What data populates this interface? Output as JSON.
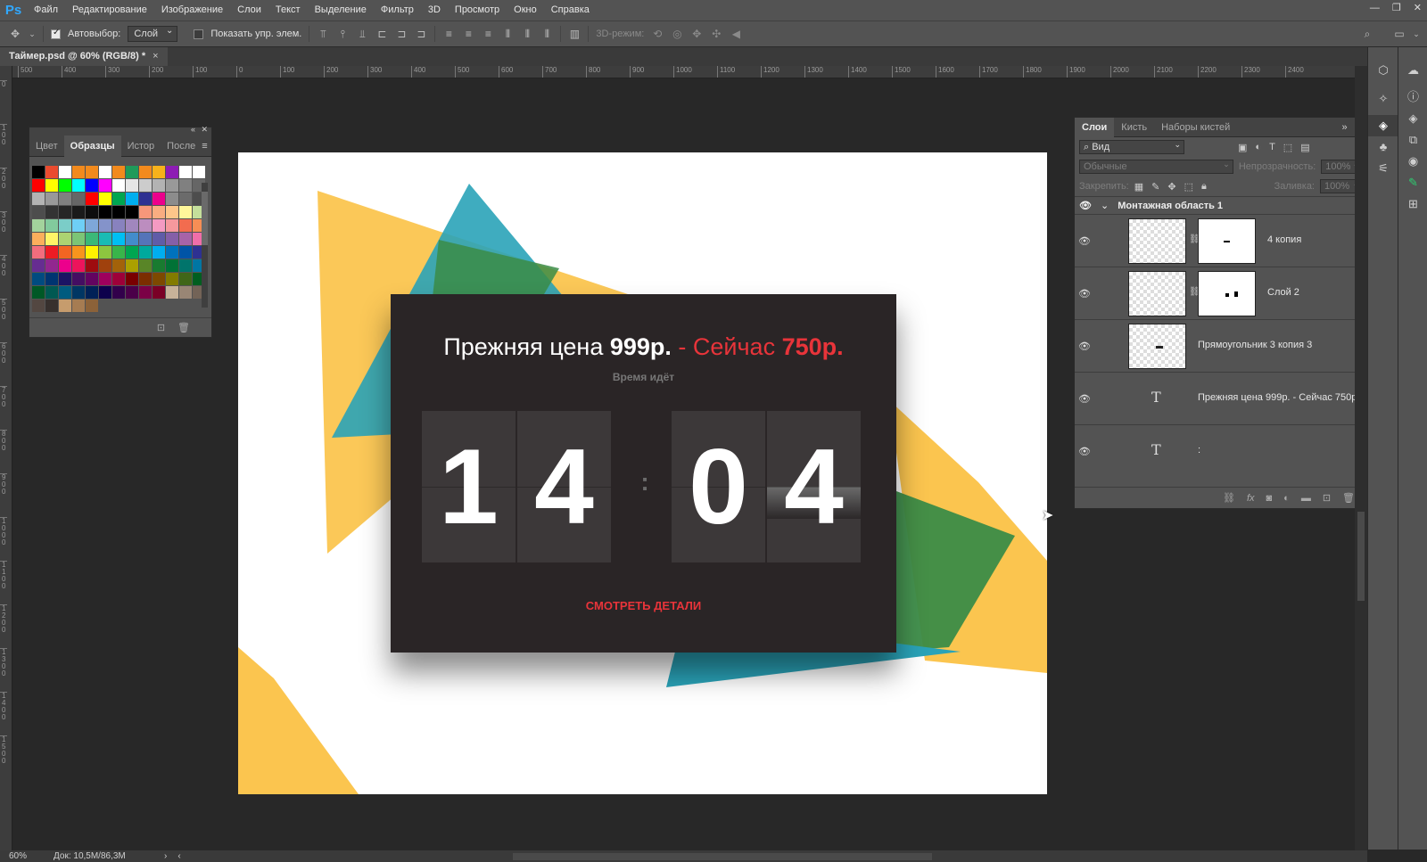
{
  "app": {
    "logo": "Ps",
    "menu": [
      "Файл",
      "Редактирование",
      "Изображение",
      "Слои",
      "Текст",
      "Выделение",
      "Фильтр",
      "3D",
      "Просмотр",
      "Окно",
      "Справка"
    ],
    "window_controls": [
      "—",
      "❐",
      "✕"
    ]
  },
  "options": {
    "autoselect_label": "Автовыбор:",
    "autoselect_checked": true,
    "autoselect_value": "Слой",
    "show_controls_label": "Показать упр. элем.",
    "mode3d_label": "3D-режим:"
  },
  "document": {
    "tab_title": "Таймер.psd @ 60% (RGB/8) *",
    "close": "×"
  },
  "rulers": {
    "h": [
      "500",
      "400",
      "300",
      "200",
      "100",
      "0",
      "100",
      "200",
      "300",
      "400",
      "500",
      "600",
      "700",
      "800",
      "900",
      "1000",
      "1100",
      "1200",
      "1300",
      "1400",
      "1500",
      "1600",
      "1700",
      "1800",
      "1900",
      "2000",
      "2100",
      "2200",
      "2300",
      "2400"
    ],
    "v": [
      "0",
      "1 0 0",
      "2 0 0",
      "3 0 0",
      "4 0 0",
      "5 0 0",
      "6 0 0",
      "7 0 0",
      "8 0 0",
      "9 0 0",
      "1 0 0 0",
      "1 1 0 0",
      "1 2 0 0",
      "1 3 0 0",
      "1 4 0 0",
      "1 5 0 0"
    ]
  },
  "artwork": {
    "headline_prefix": "Прежняя цена ",
    "headline_old_price": "999р.",
    "headline_dash": " - Сейчас ",
    "headline_new_price": "750р.",
    "subline": "Время идёт",
    "digits": [
      "1",
      "4",
      "0",
      "4"
    ],
    "colon": ":",
    "cta": "СМОТРЕТЬ ДЕТАЛИ",
    "colors": {
      "yellow": "#fbc54f",
      "teal": "#3aa9bf",
      "green": "#3b8c47",
      "card": "#2a2526",
      "red": "#e8343a"
    }
  },
  "swatches_panel": {
    "tabs": [
      "Цвет",
      "Образцы",
      "Истор",
      "После"
    ],
    "active_tab": "Образцы",
    "colors": [
      "#000000",
      "#ea4b2f",
      "#ffffff",
      "#f28a1d",
      "#f28a1d",
      "#ffffff",
      "#f28a1d",
      "#1f9a5a",
      "#f28a1d",
      "#f7b21b",
      "#8d1db4",
      "#ffffff",
      "#ffffff",
      "#ff0000",
      "#ffff00",
      "#00ff00",
      "#00ffff",
      "#0000ff",
      "#ff00ff",
      "#ffffff",
      "#e6e6e6",
      "#cccccc",
      "#b3b3b3",
      "#999999",
      "#808080",
      "#666666",
      "#b3b3b3",
      "#999999",
      "#808080",
      "#666666",
      "#ff0000",
      "#ffff00",
      "#00a650",
      "#00aeef",
      "#2e3192",
      "#ec008c",
      "#8c8c8c",
      "#6b6b6b",
      "#4d4d4d",
      "#4d4d4d",
      "#333333",
      "#262626",
      "#1a1a1a",
      "#0d0d0d",
      "#000000",
      "#000000",
      "#000000",
      "#f7977a",
      "#f9ad81",
      "#fdc68a",
      "#fff79a",
      "#c4df9b",
      "#a3d39c",
      "#82ca9d",
      "#7bcdc8",
      "#6ecff6",
      "#7ea7d8",
      "#8493ca",
      "#8882be",
      "#a187be",
      "#bc8dbf",
      "#f49ac2",
      "#f6989d",
      "#f26c4f",
      "#f68e55",
      "#fbaf5c",
      "#fff467",
      "#acd372",
      "#7cc576",
      "#3bb878",
      "#1abbb4",
      "#00bff3",
      "#438ccb",
      "#5574b9",
      "#605ca8",
      "#855fa8",
      "#a763a8",
      "#f06ea9",
      "#f26d7d",
      "#ed1c24",
      "#f26522",
      "#f7941d",
      "#fff200",
      "#8dc63f",
      "#39b54a",
      "#00a651",
      "#00a99d",
      "#00aeef",
      "#0072bc",
      "#0054a6",
      "#2e3192",
      "#662d91",
      "#92278f",
      "#ec008c",
      "#ed145b",
      "#9e0b0f",
      "#a0410d",
      "#a3620a",
      "#aba000",
      "#598527",
      "#197b30",
      "#007236",
      "#00746b",
      "#0076a3",
      "#004b80",
      "#003471",
      "#1b1464",
      "#440e62",
      "#630460",
      "#9e005d",
      "#9e0039",
      "#790000",
      "#7b2e00",
      "#7d4900",
      "#827b00",
      "#406618",
      "#005e20",
      "#005826",
      "#005952",
      "#005b7f",
      "#003663",
      "#002157",
      "#0d004c",
      "#32004b",
      "#4b0049",
      "#7b0046",
      "#7a0026",
      "#c7b299",
      "#998675",
      "#736357",
      "#534741",
      "#37302d",
      "#c69c6d",
      "#a67c52",
      "#8c6239"
    ],
    "footer_icons": [
      "new-swatch-icon",
      "trash-icon"
    ]
  },
  "layers_panel": {
    "tabs": [
      "Слои",
      "Кисть",
      "Наборы кистей"
    ],
    "active_tab": "Слои",
    "filter_label": "Вид",
    "blend_mode": "Обычные",
    "opacity_label": "Непрозрачность:",
    "opacity_value": "100%",
    "lock_label": "Закрепить:",
    "fill_label": "Заливка:",
    "fill_value": "100%",
    "group_name": "Монтажная область 1",
    "layers": [
      {
        "name": "4 копия",
        "type": "smart-masked"
      },
      {
        "name": "Слой 2",
        "type": "smart-masked"
      },
      {
        "name": "Прямоугольник 3 копия 3",
        "type": "shape"
      },
      {
        "name": "Прежняя цена 999р. - Сейчас 750р.",
        "type": "text"
      },
      {
        "name": ":",
        "type": "text"
      }
    ],
    "footer_icons": [
      "link-icon",
      "fx-icon",
      "mask-icon",
      "adjustment-icon",
      "folder-icon",
      "new-layer-icon",
      "trash-icon"
    ]
  },
  "status": {
    "zoom": "60%",
    "doc_size": "Док: 10,5M/86,3M"
  }
}
